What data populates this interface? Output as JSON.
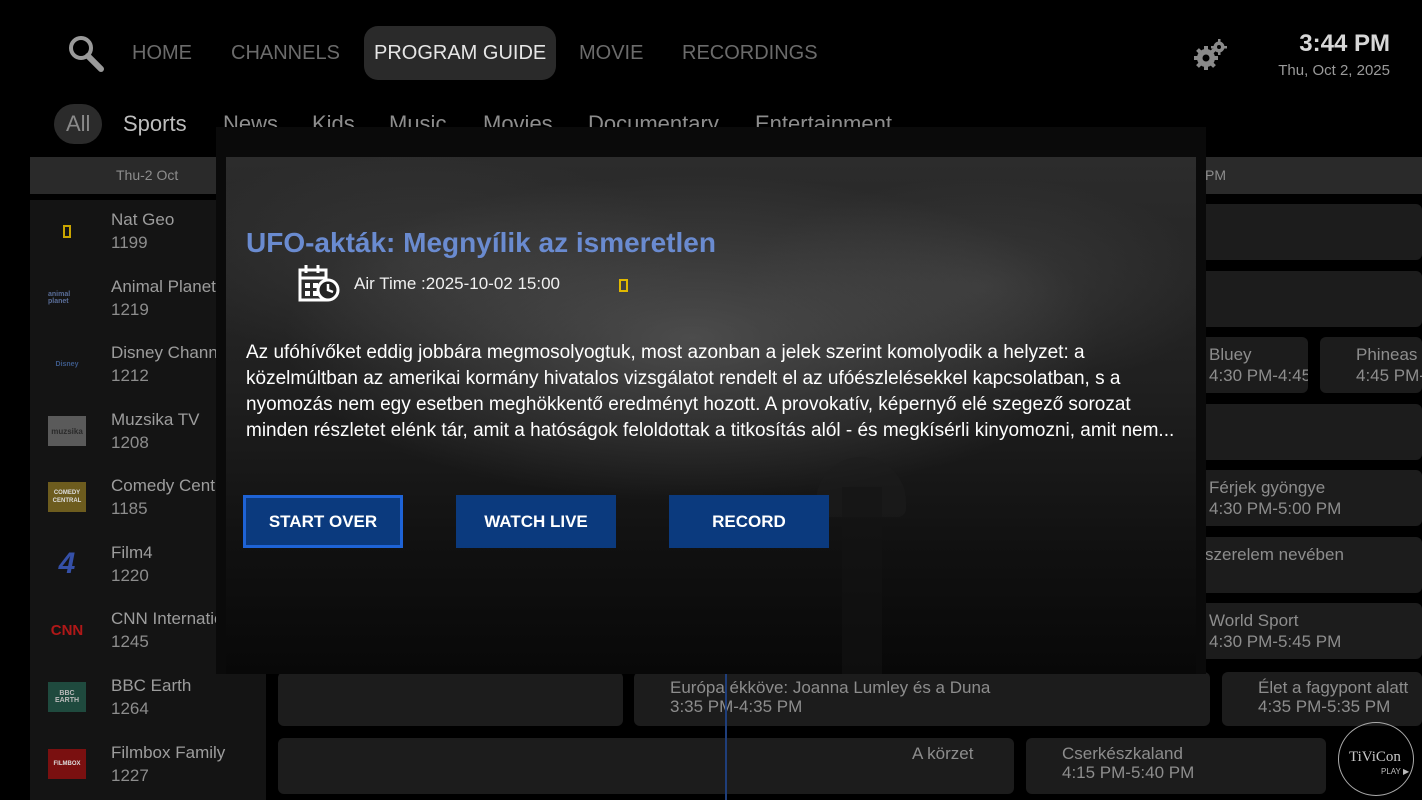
{
  "nav": {
    "items": [
      "HOME",
      "CHANNELS",
      "PROGRAM GUIDE",
      "MOVIE",
      "RECORDINGS"
    ],
    "active": "PROGRAM GUIDE",
    "search_icon": "search-icon",
    "settings_icon": "gear-icon"
  },
  "clock": {
    "time": "3:44 PM",
    "date": "Thu, Oct 2, 2025"
  },
  "categories": [
    "All",
    "Sports",
    "News",
    "Kids",
    "Music",
    "Movies",
    "Documentary",
    "Entertainment"
  ],
  "guide": {
    "date_label": "Thu-2 Oct",
    "right_time_label": "PM",
    "channels": [
      {
        "name": "Nat Geo",
        "number": "1199",
        "logo": "YELLOW FRAME"
      },
      {
        "name": "Animal Planet",
        "number": "1219",
        "logo": "animal planet"
      },
      {
        "name": "Disney Channel",
        "number": "1212",
        "logo": "Disney"
      },
      {
        "name": "Muzsika TV",
        "number": "1208",
        "logo": "muzsika"
      },
      {
        "name": "Comedy Central",
        "number": "1185",
        "logo": "COMEDY CENTRAL"
      },
      {
        "name": "Film4",
        "number": "1220",
        "logo": "4"
      },
      {
        "name": "CNN International",
        "number": "1245",
        "logo": "CNN"
      },
      {
        "name": "BBC Earth",
        "number": "1264",
        "logo": "BBC EARTH"
      },
      {
        "name": "Filmbox Family",
        "number": "1227",
        "logo": "FILMBOX"
      }
    ],
    "programs": {
      "bluey_title": "Bluey",
      "bluey_time": "4:30 PM-4:45",
      "phineas_title": "Phineas",
      "phineas_time": "4:45 PM-",
      "ferjek_title": "Férjek gyöngye",
      "ferjek_time": "4:30 PM-5:00 PM",
      "szerelem_title": "szerelem nevében",
      "worldsport_title": "World Sport",
      "worldsport_time": "4:30 PM-5:45 PM",
      "europa_title": "Európa ékköve: Joanna Lumley és a Duna",
      "europa_time": "3:35 PM-4:35 PM",
      "elet_title": "Élet a fagypont alatt",
      "elet_time": "4:35 PM-5:35 PM",
      "korzet_title": "A körzet",
      "cserkesz_title": "Cserkészkaland",
      "cserkesz_time": "4:15 PM-5:40 PM"
    }
  },
  "modal": {
    "title": "UFO-akták: Megnyílik az ismeretlen",
    "air_time": "Air Time :2025-10-02 15:00",
    "description": "Az ufóhívőket eddig jobbára megmosolyogtuk, most azonban a jelek szerint komolyodik a helyzet: a közelmúltban az amerikai kormány hivatalos vizsgálatot rendelt el az ufóészlelésekkel kapcsolatban, s a nyomozás nem egy esetben meghökkentő eredményt hozott. A provokatív, képernyő elé szegező sorozat minden részletet elénk tár, amit a hatóságok feloldottak a titkosítás alól - és megkísérli kinyomozni, amit nem...",
    "buttons": [
      "START OVER",
      "WATCH LIVE",
      "RECORD"
    ],
    "focused_button": "START OVER"
  },
  "watermark": {
    "name": "TiViCon",
    "sub": "PLAY ▶"
  },
  "colors": {
    "accent_title": "#6a8bd0",
    "button_bg": "#0b3a7e",
    "focus_border": "#1e63d6"
  }
}
